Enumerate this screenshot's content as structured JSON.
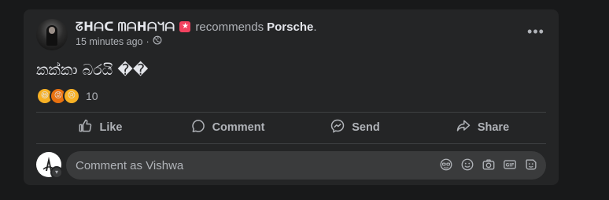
{
  "post": {
    "author": "ᘔᕼᗩᑕ ᗰᗩᕼᗩᖻᗩ",
    "action_text": "recommends",
    "page_name": "Porsche",
    "page_suffix": ".",
    "timestamp": "15 minutes ago",
    "separator": "·",
    "privacy_icon": "globe-icon",
    "content": "කක්කා බරයි ��",
    "reactions": {
      "types": [
        "haha",
        "angry",
        "sad"
      ],
      "count": "10"
    }
  },
  "actions": {
    "like": "Like",
    "comment": "Comment",
    "send": "Send",
    "share": "Share"
  },
  "comment_box": {
    "placeholder": "Comment as Vishwa",
    "tools": [
      "avatar-sticker-icon",
      "emoji-icon",
      "camera-icon",
      "gif-icon",
      "sticker-icon"
    ]
  },
  "colors": {
    "background": "#18191a",
    "card": "#242526",
    "text": "#e4e6eb",
    "secondary_text": "#b0b3b8",
    "input_bg": "#3a3b3c",
    "badge": "#f3425f"
  }
}
